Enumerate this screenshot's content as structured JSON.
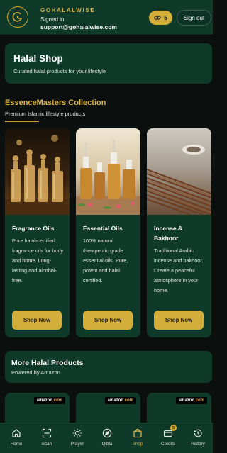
{
  "header": {
    "brand_name": "GOHALALWISE",
    "signed_in_label": "Signed in",
    "email": "support@gohalalwise.com",
    "credits_count": "5",
    "signout_label": "Sign out"
  },
  "hero": {
    "title": "Halal Shop",
    "subtitle": "Curated halal products for your lifestyle"
  },
  "collection": {
    "title": "EssenceMasters Collection",
    "subtitle": "Premium Islamic lifestyle products",
    "products": [
      {
        "title": "Fragrance Oils",
        "description": "Pure halal-certified fragrance oils for body and home. Long-lasting and alcohol-free.",
        "button": "Shop Now"
      },
      {
        "title": "Essential Oils",
        "description": "100% natural therapeutic grade essential oils. Pure, potent and halal certified.",
        "button": "Shop Now"
      },
      {
        "title": "Incense & Bakhoor",
        "description": "Traditional Arabic incense and bakhoor. Create a peaceful atmosphere in your home.",
        "button": "Shop Now"
      }
    ]
  },
  "more": {
    "title": "More Halal Products",
    "subtitle": "Powered by Amazon",
    "badge_prefix": "amazon",
    "badge_suffix": ".com"
  },
  "nav": {
    "items": [
      {
        "label": "Home",
        "icon": "home-icon"
      },
      {
        "label": "Scan",
        "icon": "scan-icon"
      },
      {
        "label": "Prayer",
        "icon": "sun-icon"
      },
      {
        "label": "Qibla",
        "icon": "compass-icon"
      },
      {
        "label": "Shop",
        "icon": "bag-icon"
      },
      {
        "label": "Credits",
        "icon": "card-icon"
      },
      {
        "label": "History",
        "icon": "history-icon"
      }
    ],
    "active": "Shop",
    "credits_badge": "5"
  },
  "colors": {
    "accent_gold": "#d4ae3a",
    "panel_green": "#0f3a2a",
    "background": "#0b0f0d"
  }
}
